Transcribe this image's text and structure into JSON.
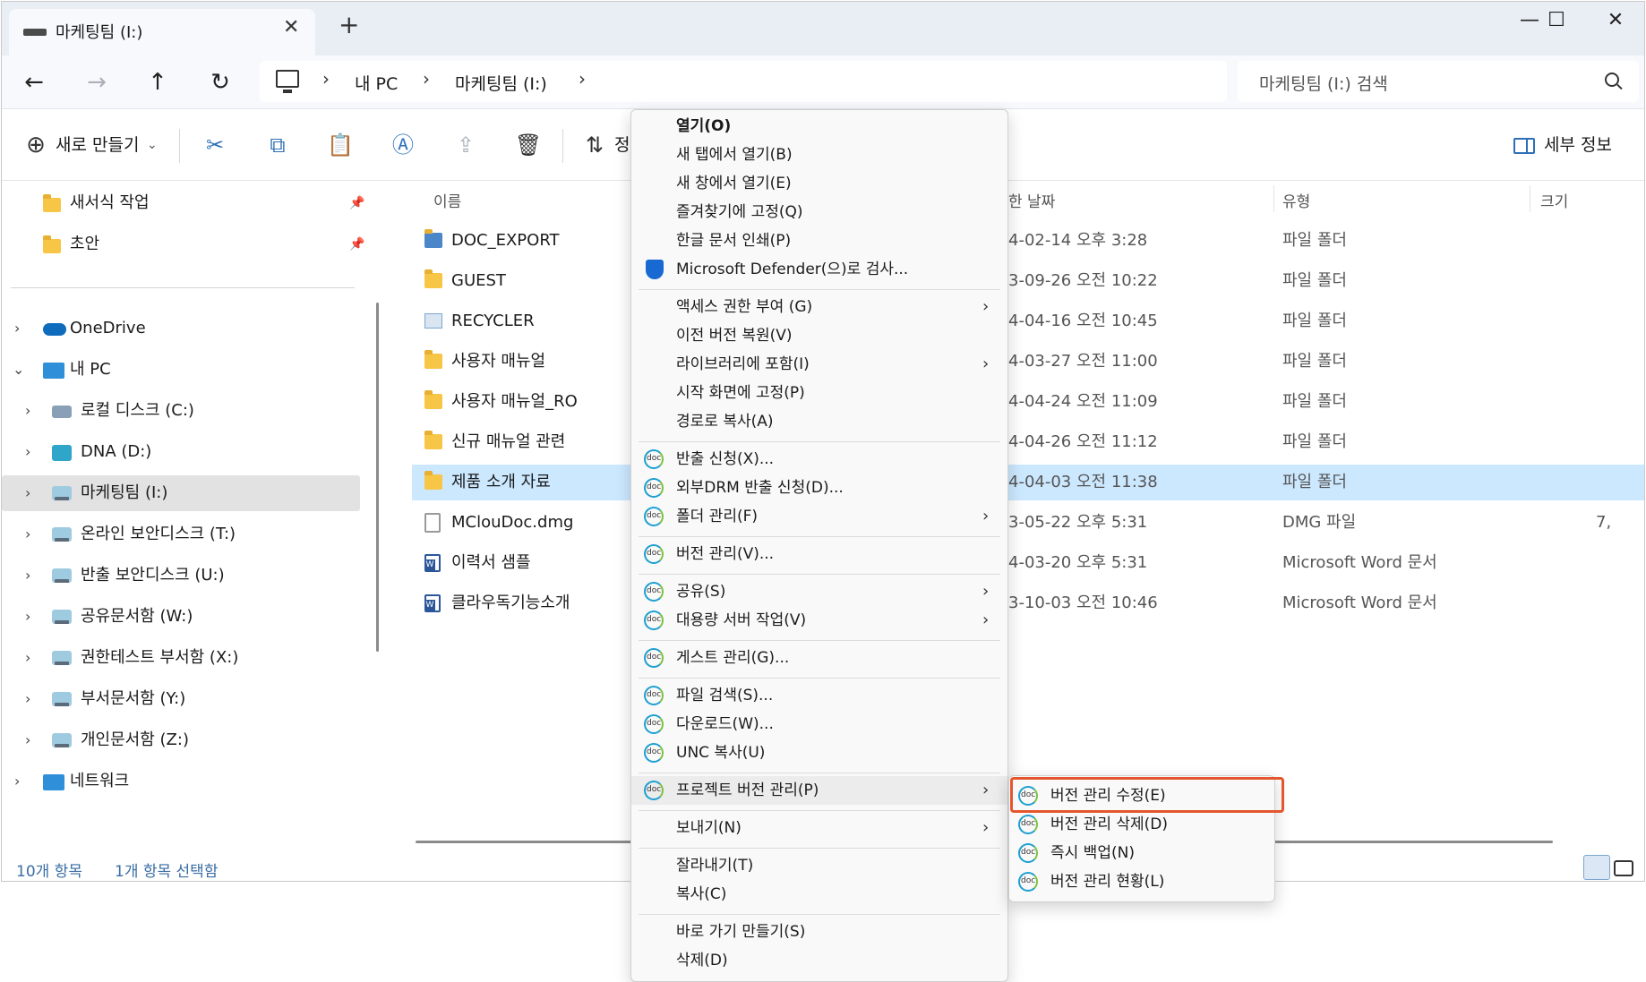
{
  "window": {
    "tab_title": "마케팅팀 (I:)",
    "close_tab": "✕",
    "new_tab": "+",
    "minimize": "—",
    "maximize": "☐",
    "close": "✕"
  },
  "nav": {
    "back": "←",
    "forward": "→",
    "up": "↑",
    "refresh": "↻",
    "breadcrumb": [
      "내 PC",
      "마케팅팀 (I:)"
    ],
    "sep": "›",
    "search_placeholder": "마케팅팀 (I:) 검색"
  },
  "toolbar": {
    "new_label": "새로 만들기",
    "new_caret": "⌄",
    "sort_label": "정",
    "details_label": "세부 정보"
  },
  "navpane": {
    "quick": [
      {
        "label": "새서식 작업",
        "pinned": true
      },
      {
        "label": "초안",
        "pinned": true
      }
    ],
    "onedrive": "OneDrive",
    "pc": "내 PC",
    "drives": [
      {
        "label": "로컬 디스크 (C:)"
      },
      {
        "label": "DNA (D:)"
      },
      {
        "label": "마케팅팀 (I:)",
        "selected": true
      },
      {
        "label": "온라인 보안디스크 (T:)"
      },
      {
        "label": "반출 보안디스크 (U:)"
      },
      {
        "label": "공유문서함 (W:)"
      },
      {
        "label": "권한테스트 부서함 (X:)"
      },
      {
        "label": "부서문서함 (Y:)"
      },
      {
        "label": "개인문서함 (Z:)"
      }
    ],
    "network": "네트워크"
  },
  "filelist": {
    "headers": {
      "name": "이름",
      "date": "한 날짜",
      "type": "유형",
      "size": "크기"
    },
    "rows": [
      {
        "name": "DOC_EXPORT",
        "date": "4-02-14 오후 3:28",
        "type": "파일 폴더",
        "size": ""
      },
      {
        "name": "GUEST",
        "date": "3-09-26 오전 10:22",
        "type": "파일 폴더",
        "size": ""
      },
      {
        "name": "RECYCLER",
        "date": "4-04-16 오전 10:45",
        "type": "파일 폴더",
        "size": ""
      },
      {
        "name": "사용자 매뉴얼",
        "date": "4-03-27 오전 11:00",
        "type": "파일 폴더",
        "size": ""
      },
      {
        "name": "사용자 매뉴얼_RO",
        "date": "4-04-24 오전 11:09",
        "type": "파일 폴더",
        "size": ""
      },
      {
        "name": "신규 매뉴얼 관련",
        "date": "4-04-26 오전 11:12",
        "type": "파일 폴더",
        "size": ""
      },
      {
        "name": "제품 소개 자료",
        "date": "4-04-03 오전 11:38",
        "type": "파일 폴더",
        "size": "",
        "selected": true
      },
      {
        "name": "MClouDoc.dmg",
        "date": "3-05-22 오후 5:31",
        "type": "DMG 파일",
        "size": "7,"
      },
      {
        "name": "이력서 샘플",
        "date": "4-03-20 오후 5:31",
        "type": "Microsoft Word 문서",
        "size": ""
      },
      {
        "name": "클라우독기능소개",
        "date": "3-10-03 오전 10:46",
        "type": "Microsoft Word 문서",
        "size": ""
      }
    ]
  },
  "status": {
    "count": "10개 항목",
    "selected": "1개 항목 선택함"
  },
  "context_menu": {
    "items": [
      {
        "label": "열기(O)"
      },
      {
        "label": "새 탭에서 열기(B)"
      },
      {
        "label": "새 창에서 열기(E)"
      },
      {
        "label": "즐겨찾기에 고정(Q)"
      },
      {
        "label": "한글 문서 인쇄(P)"
      },
      {
        "label": "Microsoft Defender(으)로 검사..."
      },
      {
        "label": "액세스 권한 부여 (G)"
      },
      {
        "label": "이전 버전 복원(V)"
      },
      {
        "label": "라이브러리에 포함(I)"
      },
      {
        "label": "시작 화면에 고정(P)"
      },
      {
        "label": "경로로 복사(A)"
      },
      {
        "label": "반출 신청(X)..."
      },
      {
        "label": "외부DRM 반출 신청(D)..."
      },
      {
        "label": "폴더 관리(F)"
      },
      {
        "label": "버전 관리(V)..."
      },
      {
        "label": "공유(S)"
      },
      {
        "label": "대용량 서버 작업(V)"
      },
      {
        "label": "게스트 관리(G)..."
      },
      {
        "label": "파일 검색(S)..."
      },
      {
        "label": "다운로드(W)..."
      },
      {
        "label": "UNC 복사(U)"
      },
      {
        "label": "프로젝트 버전 관리(P)"
      },
      {
        "label": "보내기(N)"
      },
      {
        "label": "잘라내기(T)"
      },
      {
        "label": "복사(C)"
      },
      {
        "label": "바로 가기 만들기(S)"
      },
      {
        "label": "삭제(D)"
      }
    ],
    "arrow": "›",
    "icon_text": "doc"
  },
  "submenu": {
    "items": [
      {
        "label": "버전 관리 수정(E)",
        "highlighted": true
      },
      {
        "label": "버전 관리 삭제(D)"
      },
      {
        "label": "즉시 백업(N)"
      },
      {
        "label": "버전 관리 현황(L)"
      }
    ]
  },
  "colors": {
    "accent": "#2d6fb7",
    "selection": "#cce8ff",
    "highlight_box": "#e4572e"
  }
}
